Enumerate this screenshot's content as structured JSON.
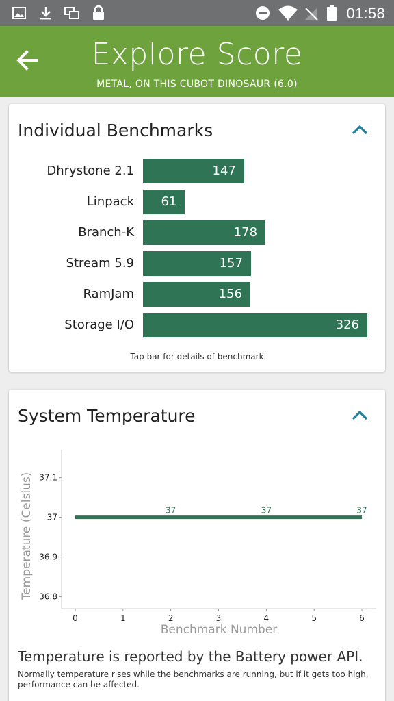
{
  "status_bar": {
    "time": "01:58",
    "icons": [
      "image-icon",
      "download-icon",
      "multiwindow-icon",
      "lock-icon",
      "do-not-disturb-icon",
      "wifi-icon",
      "no-signal-icon",
      "battery-icon"
    ]
  },
  "app_bar": {
    "back_icon": "arrow-left-icon",
    "title": "Explore Score",
    "subtitle": "METAL, ON THIS CUBOT DINOSAUR (6.0)",
    "color": "#6ea23c"
  },
  "benchmarks_card": {
    "title": "Individual Benchmarks",
    "collapse_icon": "chevron-up-icon",
    "hint": "Tap bar for details of benchmark",
    "bar_color": "#2f7454",
    "items": [
      {
        "label": "Dhrystone 2.1",
        "value": "147"
      },
      {
        "label": "Linpack",
        "value": "61"
      },
      {
        "label": "Branch-K",
        "value": "178"
      },
      {
        "label": "Stream 5.9",
        "value": "157"
      },
      {
        "label": "RamJam",
        "value": "156"
      },
      {
        "label": "Storage I/O",
        "value": "326"
      }
    ]
  },
  "temperature_card": {
    "title": "System Temperature",
    "collapse_icon": "chevron-up-icon",
    "note": "Temperature is reported by the Battery power API.",
    "note_detail": "Normally temperature rises while the benchmarks are running, but if it gets too high, performance can be affected."
  },
  "chart_data": {
    "type": "line",
    "xlabel": "Benchmark Number",
    "ylabel": "Temperature (Celsius)",
    "x_ticks": [
      "0",
      "1",
      "2",
      "3",
      "4",
      "5",
      "6"
    ],
    "y_ticks": [
      "37.1",
      "37",
      "36.9",
      "36.8"
    ],
    "xlim": [
      0,
      6
    ],
    "ylim": [
      36.77,
      37.17
    ],
    "grid": false,
    "line_color": "#2f7454",
    "series": [
      {
        "x": [
          0,
          1,
          2,
          3,
          4,
          5,
          6
        ],
        "y": [
          37,
          37,
          37,
          37,
          37,
          37,
          37
        ]
      }
    ],
    "point_labels": [
      {
        "x": 2,
        "y": 37,
        "text": "37"
      },
      {
        "x": 4,
        "y": 37,
        "text": "37"
      },
      {
        "x": 6,
        "y": 37,
        "text": "37"
      }
    ]
  }
}
